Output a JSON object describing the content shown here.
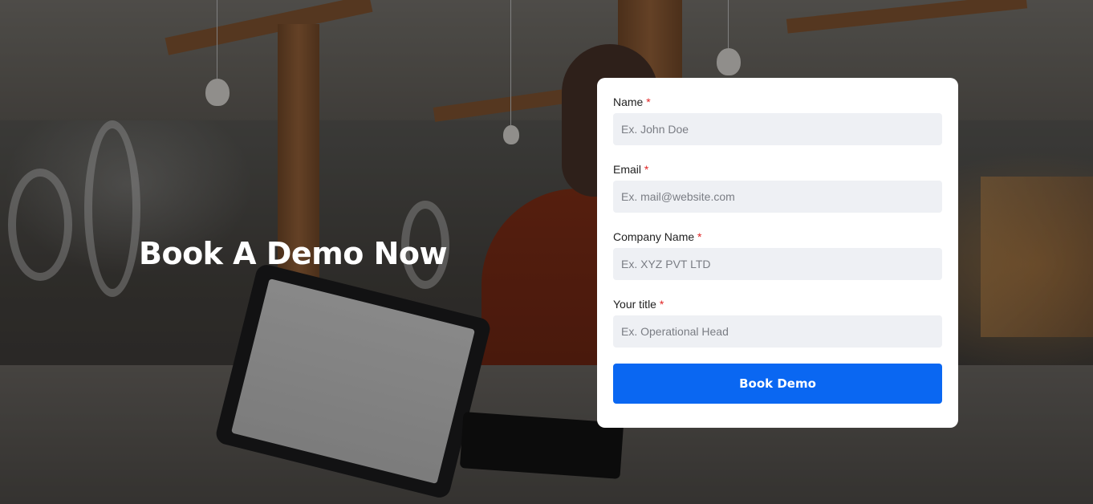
{
  "hero": {
    "title": "Book A Demo Now"
  },
  "form": {
    "fields": [
      {
        "label": "Name",
        "required_mark": "*",
        "placeholder": "Ex. John Doe",
        "value": ""
      },
      {
        "label": "Email",
        "required_mark": "*",
        "placeholder": "Ex. mail@website.com",
        "value": ""
      },
      {
        "label": "Company Name",
        "required_mark": "*",
        "placeholder": "Ex. XYZ PVT LTD",
        "value": ""
      },
      {
        "label": "Your title",
        "required_mark": "*",
        "placeholder": "Ex. Operational Head",
        "value": ""
      }
    ],
    "submit_label": "Book Demo"
  },
  "colors": {
    "accent": "#0a67f2",
    "required": "#e02424",
    "input_bg": "#eef0f4",
    "card_bg": "#ffffff",
    "hero_text": "#ffffff"
  }
}
